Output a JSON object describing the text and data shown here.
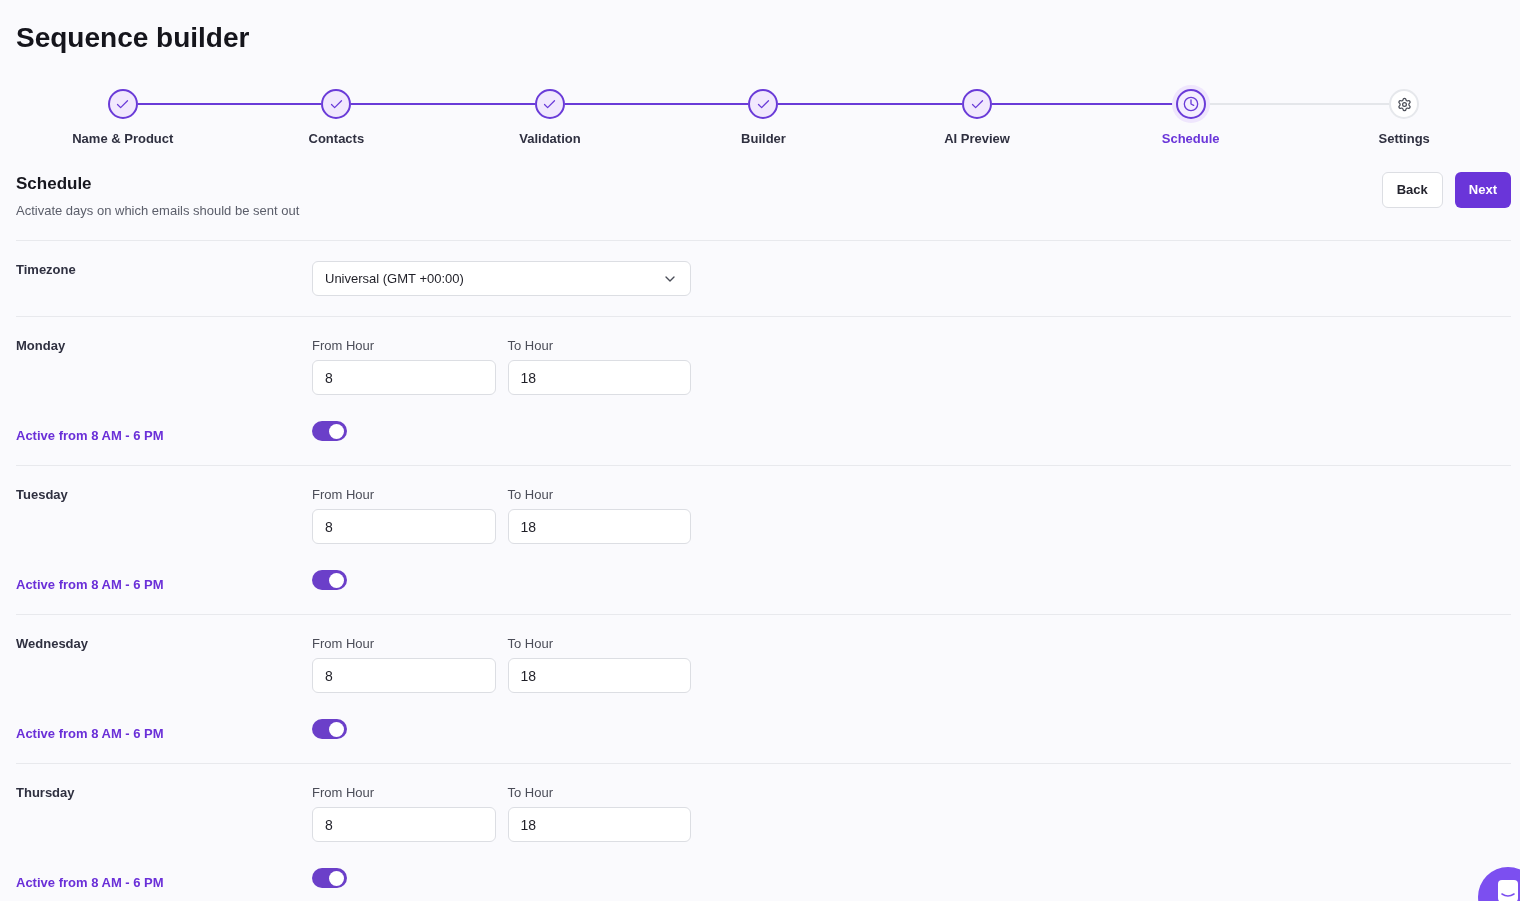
{
  "page": {
    "title": "Sequence builder"
  },
  "steps": [
    {
      "label": "Name & Product",
      "done": true,
      "selected": false
    },
    {
      "label": "Contacts",
      "done": true,
      "selected": false
    },
    {
      "label": "Validation",
      "done": true,
      "selected": false
    },
    {
      "label": "Builder",
      "done": true,
      "selected": false
    },
    {
      "label": "AI Preview",
      "done": true,
      "selected": false
    },
    {
      "label": "Schedule",
      "done": false,
      "selected": true
    },
    {
      "label": "Settings",
      "done": false,
      "selected": false
    }
  ],
  "section": {
    "title": "Schedule",
    "description": "Activate days on which emails should be sent out",
    "buttons": [
      {
        "label": "Back",
        "kind": "secondary"
      },
      {
        "label": "Next",
        "kind": "primary"
      }
    ]
  },
  "timezone": {
    "label": "Timezone",
    "value": "Universal (GMT +00:00)"
  },
  "days": [
    {
      "name": "Monday",
      "from_label": "From Hour",
      "from_value": "8",
      "to_label": "To Hour",
      "to_value": "18",
      "status": "Active from 8 AM - 6 PM",
      "active": true
    },
    {
      "name": "Tuesday",
      "from_label": "From Hour",
      "from_value": "8",
      "to_label": "To Hour",
      "to_value": "18",
      "status": "Active from 8 AM - 6 PM",
      "active": true
    },
    {
      "name": "Wednesday",
      "from_label": "From Hour",
      "from_value": "8",
      "to_label": "To Hour",
      "to_value": "18",
      "status": "Active from 8 AM - 6 PM",
      "active": true
    },
    {
      "name": "Thursday",
      "from_label": "From Hour",
      "from_value": "8",
      "to_label": "To Hour",
      "to_value": "18",
      "status": "Active from 8 AM - 6 PM",
      "active": true
    }
  ]
}
